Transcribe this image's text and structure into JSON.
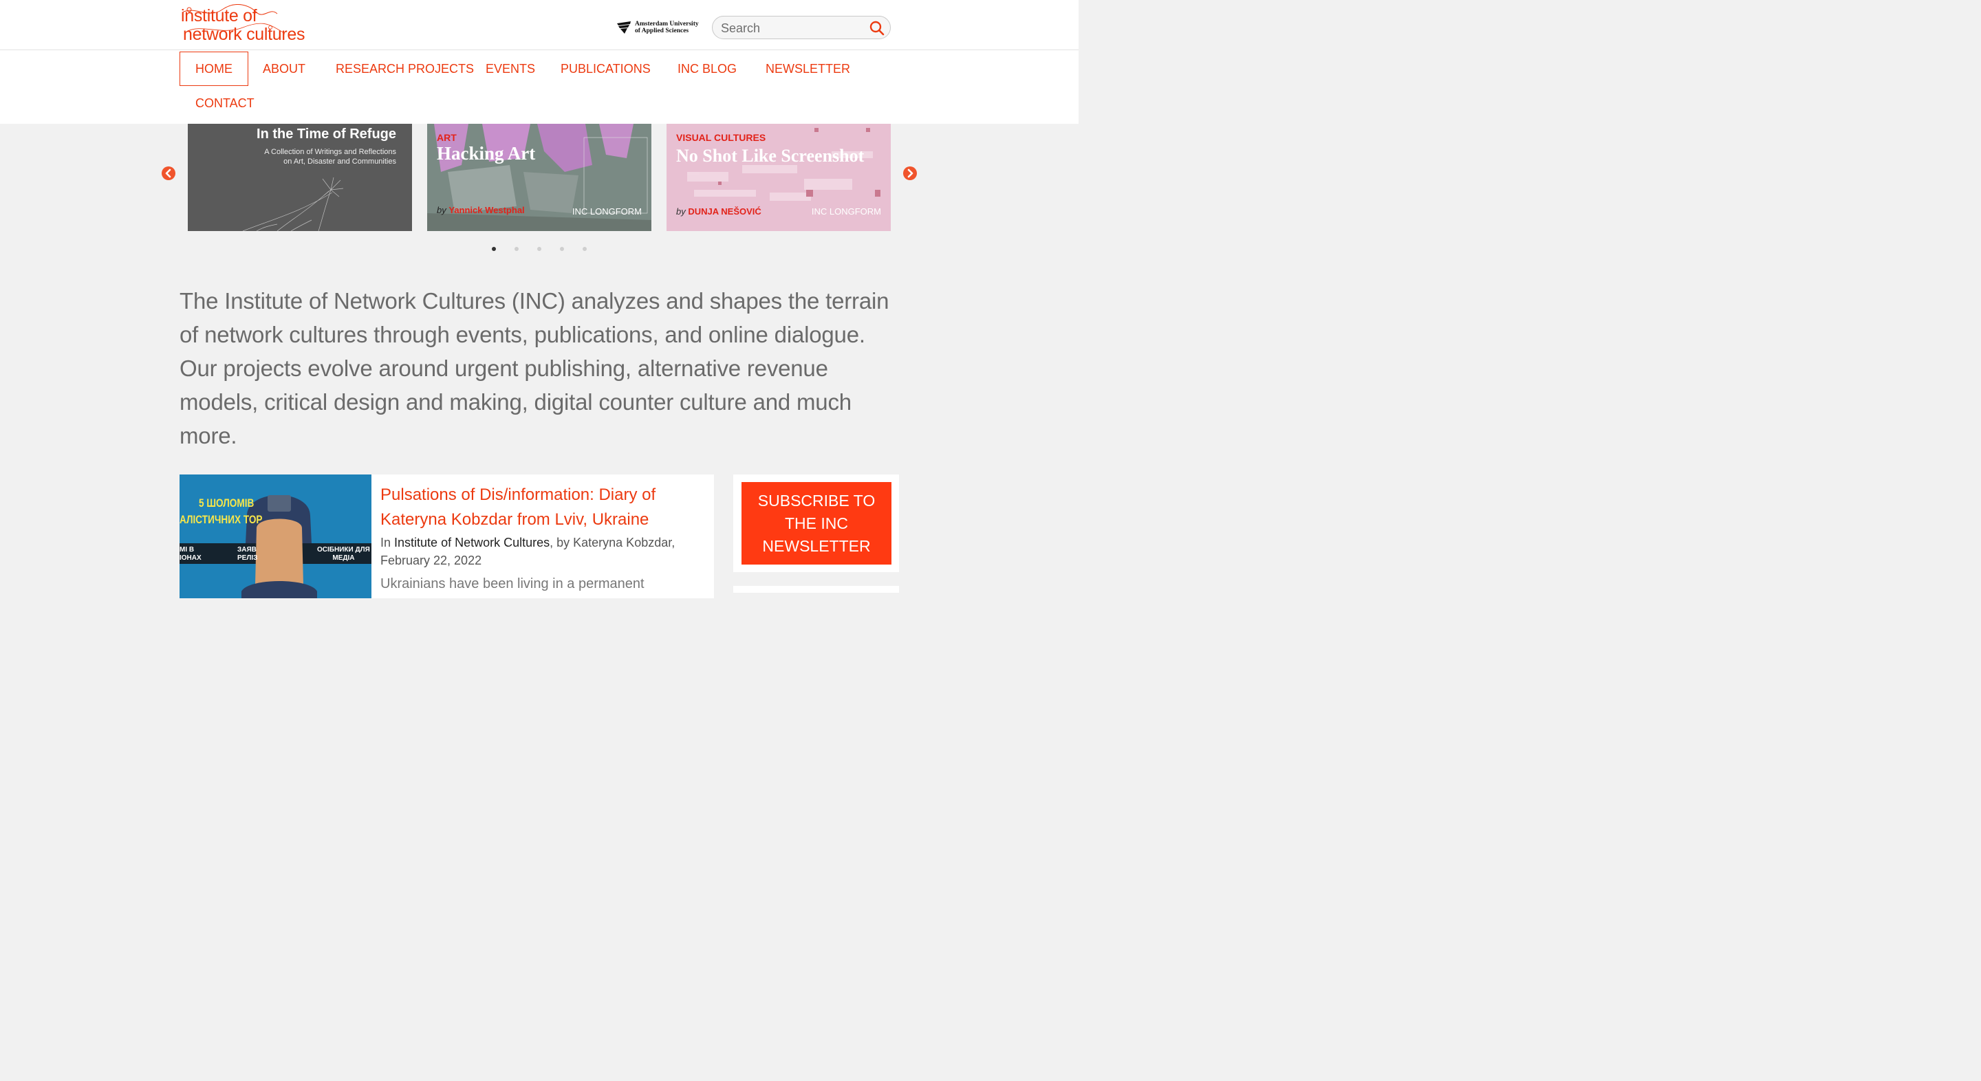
{
  "header": {
    "logo_line1": "institute of",
    "logo_line2": "network cultures",
    "partner": "Amsterdam University of Applied Sciences",
    "partner_line1": "Amsterdam University",
    "partner_line2": "of Applied Sciences",
    "search": {
      "placeholder": "Search",
      "value": ""
    },
    "search_icon": "magnifier-icon"
  },
  "nav": {
    "items": [
      {
        "label": "HOME",
        "active": true
      },
      {
        "label": "ABOUT"
      },
      {
        "label": "RESEARCH PROJECTS"
      },
      {
        "label": "EVENTS"
      },
      {
        "label": "PUBLICATIONS"
      },
      {
        "label": "INC BLOG"
      },
      {
        "label": "NEWSLETTER"
      },
      {
        "label": "CONTACT"
      }
    ]
  },
  "carousel": {
    "prev_icon": "chevron-left-icon",
    "next_icon": "chevron-right-icon",
    "slides": [
      {
        "title": "In the Time of Refuge",
        "subtitle_line1": "A Collection of Writings and Reflections",
        "subtitle_line2": "on Art, Disaster and Communities"
      },
      {
        "category": "ART",
        "title": "Hacking Art",
        "author_prefix": "by",
        "author": "Yannick Westphal",
        "series": "INC LONGFORM"
      },
      {
        "category": "VISUAL CULTURES",
        "title": "No Shot Like Screenshot",
        "author_prefix": "by",
        "author": "DUNJA NEŠOVIĆ",
        "series": "INC LONGFORM"
      }
    ],
    "dots": 5,
    "active_dot": 1
  },
  "intro": "The Institute of Network Cultures (INC) analyzes and shapes the terrain of network cultures through events, publications, and online dialogue. Our projects evolve around urgent publishing, alternative revenue models, critical design and making, digital counter culture and much more.",
  "post": {
    "thumb_text_1": "5 ШОЛОМІВ",
    "thumb_text_2": "АЛІСТИЧНИХ ТОР",
    "thumb_text_3": "МІ В",
    "thumb_text_4": "ІОНАХ",
    "thumb_text_5": "ЗАЯВ",
    "thumb_text_6": "РЕЛІЗ",
    "thumb_text_7": "ОСІБНИКИ ДЛЯ",
    "thumb_text_8": "МЕДІА",
    "title": "Pulsations of Dis/information: Diary of Kateryna Kobzdar from Lviv, Ukraine",
    "meta_in": "In",
    "meta_category": "Institute of Network Cultures",
    "meta_rest": ", by Kateryna Kobzdar, February 22, 2022",
    "excerpt": "Ukrainians have been living in a permanent"
  },
  "sidebar": {
    "subscribe": "SUBSCRIBE TO THE INC NEWSLETTER",
    "subscribe_line1": "SUBSCRIBE TO",
    "subscribe_line2": "THE INC",
    "subscribe_line3": "NEWSLETTER"
  },
  "colors": {
    "accent": "#ec3a10",
    "button": "#ff3a12",
    "background": "#f1f1f1"
  }
}
